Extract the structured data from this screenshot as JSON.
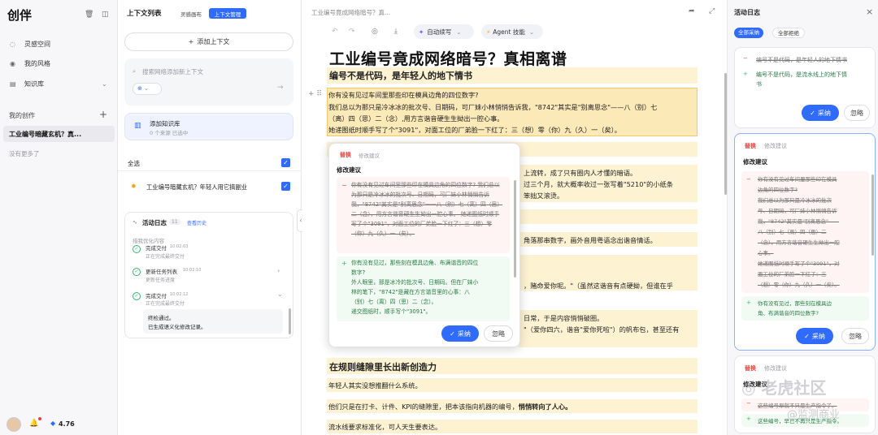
{
  "sidebar": {
    "logo": "创伴",
    "nav": [
      {
        "label": "灵感空间",
        "icon": "lightbulb-icon"
      },
      {
        "label": "我的风格",
        "icon": "palette-icon"
      },
      {
        "label": "知识库",
        "icon": "book-icon"
      }
    ],
    "my_creations_title": "我的创作",
    "doc_item": "工业编号暗藏玄机？真...",
    "no_more": "没有更多了",
    "credits": "4.76"
  },
  "context": {
    "title": "上下文列表",
    "tabs": [
      "灵感画布",
      "上下文管理"
    ],
    "add_context": "添加上下文",
    "search_placeholder": "搜索网络添加新上下文",
    "kb_title": "添加知识库",
    "kb_sub": "0 个来源 已选中",
    "select_all": "全选",
    "item_label": "工业编号暗藏玄机？年轻人用它搞副业",
    "log_title": "活动日志",
    "log_count": "11",
    "log_view": "查看历史",
    "log_optimizing": "措我优化内容",
    "log_entries": [
      {
        "title": "完成交付",
        "time": "10:02:03",
        "sub": "正在完成最终交付"
      },
      {
        "title": "更新任务列表",
        "time": "10:02:10",
        "sub": "更新任务进度"
      },
      {
        "title": "完成交付",
        "time": "10:02:12",
        "sub": "正在完成最终交付"
      }
    ],
    "log_note": [
      "终检通过。",
      "已生成语义化修改记录。"
    ]
  },
  "editor": {
    "breadcrumb": "工业编号竟成网络暗号？真...",
    "auto_continue": "自动续写",
    "agent_skill": "Agent 技能",
    "title": "工业编号竟成网络暗号？真相离谱",
    "h2_1": "编号不是代码，是年轻人的地下情书",
    "p1": "你有没有见过车间里那些印在模具边角的四位数字?",
    "p2": "我们总以为那只是冷冰冰的批次号、日期码，可厂妹小林悄悄告诉我，\"8742\"其实是\"别离思念\"——八（别）七",
    "p3": "（离）四（思）二（念）,用方言谐音硬生生拗出一腔心事。",
    "p4": "她递图纸时顺手写了个\"3091\"，对面工位的厂弟脸一下红了：三（想）零（你）九（久）一（矣）。",
    "frag_a": "上流转，成了只有圈内人才懂的暗语。",
    "frag_b": "过三个月，就大概率收过一张写着\"5210\"的小纸条",
    "frag_c": "笨拙又滚烫。",
    "frag_d": "角落那串数字，画外音用粤语念出谐音情话。",
    "frag_e": "，赌命爱你呢。\"（虽然这谐音有点硬拗，但谁在乎",
    "frag_f": "日常，于是内容悄悄破圈。",
    "frag_g": "\"（爱你四六，谐音\"爱你死啦\"）的帆布包，甚至还有",
    "h2_2": "在规则缝隙里长出新创造力",
    "p5": "年轻人其实没想推翻什么系统。",
    "p6a": "他们只是在打卡、计件、KPI的缝隙里，把本该指向机器的编号，",
    "p6b": "悄悄转向了人心。",
    "p7": "流水线要求标准化，可人天生要表达。"
  },
  "popup": {
    "tag": "替换",
    "type": "修改建议",
    "heading": "修改建议",
    "del_text": "你有没有见过车间里那些印在模具边角的四位数字? 我们总以为那只是冷冰冰的批次号、日期码，可厂妹小林悄悄告诉我，\"8742\"其实是\"别离思念\"——八（别）七（离）四（思）二（念），用方言谐音硬生生拗出一腔心事。 她递图纸时顺手写了个\"3091\"，对面工位的厂弟脸一下红了：三（想）零（你）九（久）一（矣）。",
    "add_lines": [
      "你有没有见过，那些刻在模具边角、布满谐音的四位",
      "数字?",
      "外人眼里，那是冰冷的批次号、日期码。但在厂妹小",
      "林的笔下，\"8742\"是藏在方言谐音里的心事：八",
      "（别）七（离）四（思）二（念）。",
      "递交图纸时，顺手写个\"3091\"。"
    ],
    "accept": "采纳",
    "ignore": "忽略"
  },
  "right": {
    "title": "活动日志",
    "filter_accept_all": "全部采纳",
    "filter_reject_all": "全部拒绝",
    "card1_del": "编号不是代码，是年轻人的地下情书",
    "card1_add": [
      "编号不是代码，是流水线上的地下情",
      "书"
    ],
    "card2_tag": "替换",
    "card2_type": "修改建议",
    "card2_heading": "修改建议",
    "card2_del": [
      "你有没有见过车间里那些印在模具",
      "边角的四位数字?",
      "我们总以为那只是冷冰冰的批次",
      "号、日期码，可厂妹小林悄悄告诉",
      "我，\"8742\"其实是\"别离思念\"——",
      "八（别）七（离）四（思）二",
      "（念），用方言谐音硬生生拗出一腔",
      "心事。",
      "她递图纸时顺手写了个\"3091\"，对",
      "面工位的厂弟脸一下红了：三",
      "（想）零（你）九（久）一（矣）。"
    ],
    "card2_add": [
      "你有没有见过，那些刻在模具边",
      "角、布满谐音的四位数字?"
    ],
    "card3_tag": "替换",
    "card3_type": "修改建议",
    "card3_heading": "修改建议",
    "card3_del": "这些编号早就不只是生产指令了。",
    "card3_add": "这些编号，早已不再只是生产指令。",
    "accept": "采纳",
    "ignore": "忽略"
  },
  "watermark": [
    "老虎社区",
    "@监测商业"
  ]
}
